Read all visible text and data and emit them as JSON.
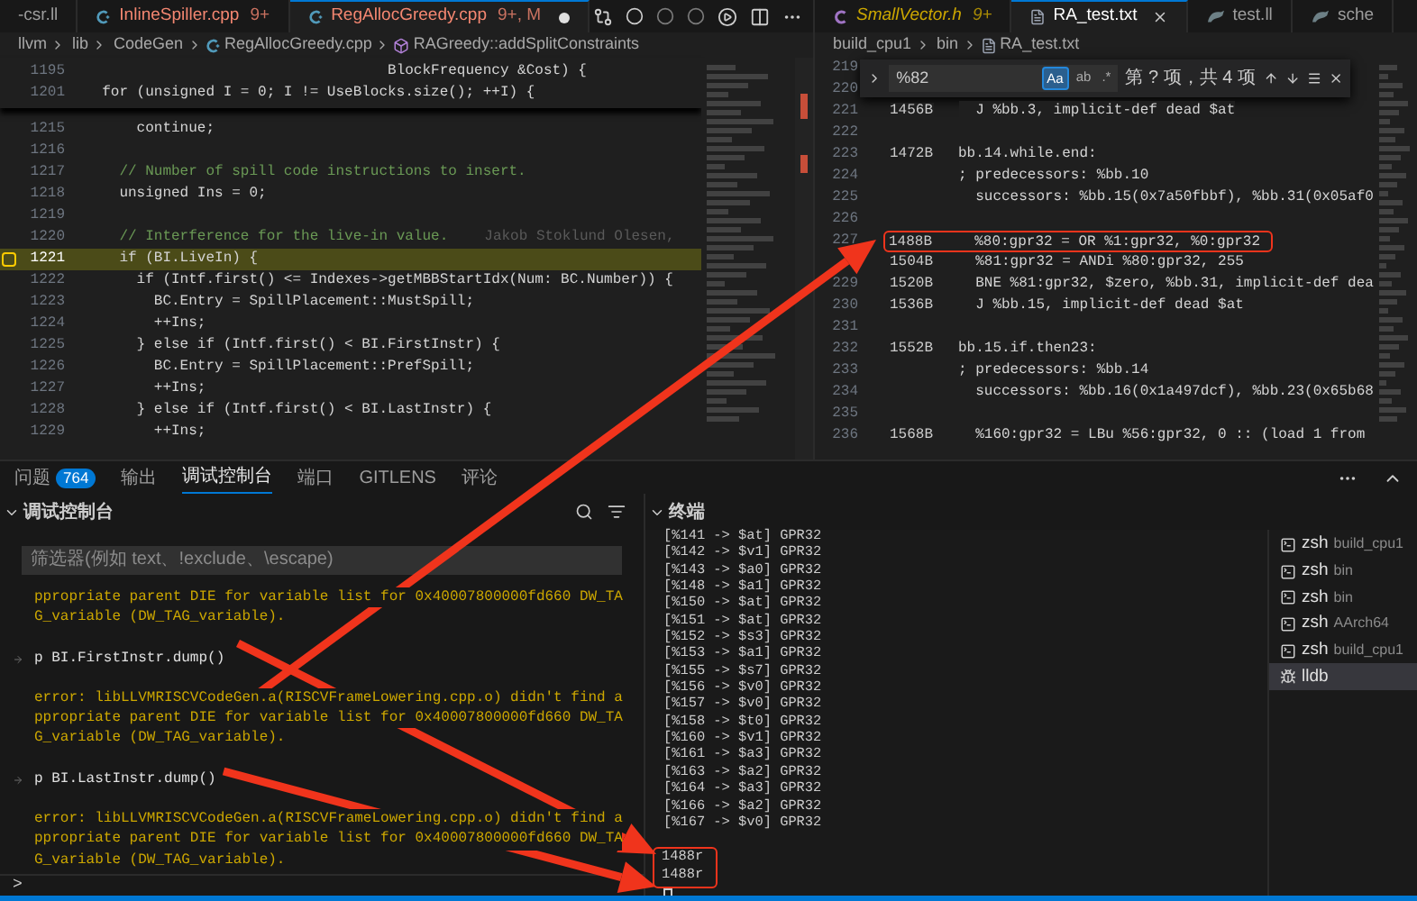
{
  "editor_left": {
    "tabs": [
      {
        "label": "-csr.ll",
        "kind": "none",
        "error": false,
        "warning": false,
        "selected": false,
        "dirty": false
      },
      {
        "label": "InlineSpiller.cpp",
        "badge": "9+",
        "kind": "cpp",
        "error": true,
        "warning": false,
        "selected": false,
        "dirty": false
      },
      {
        "label": "RegAllocGreedy.cpp",
        "badge": "9+, M",
        "kind": "cpp",
        "error": true,
        "warning": false,
        "selected": true,
        "dirty": true
      }
    ],
    "breadcrumbs": [
      {
        "label": "llvm",
        "kind": "folder"
      },
      {
        "label": "lib",
        "kind": "folder"
      },
      {
        "label": "CodeGen",
        "kind": "folder"
      },
      {
        "label": "RegAllocGreedy.cpp",
        "kind": "cpp"
      },
      {
        "label": "RAGreedy::addSplitConstraints",
        "kind": "method"
      }
    ],
    "sticky_lines": [
      {
        "number": "1195",
        "text": "                                   BlockFrequency &Cost) {"
      },
      {
        "number": "1201",
        "text": "  for (unsigned I = 0; I != UseBlocks.size(); ++I) {"
      }
    ],
    "lines": [
      {
        "number": "1215",
        "kind": "code",
        "text": "      continue;",
        "current": false
      },
      {
        "number": "1216",
        "kind": "blank",
        "current": false
      },
      {
        "number": "1217",
        "kind": "comment",
        "text": "    // Number of spill code instructions to insert.",
        "current": false
      },
      {
        "number": "1218",
        "kind": "code",
        "text": "    unsigned Ins = 0;",
        "current": false
      },
      {
        "number": "1219",
        "kind": "blank",
        "current": false
      },
      {
        "number": "1220",
        "kind": "comment",
        "text": "    // Interference for the live-in value.",
        "blame": "Jakob Stoklund Olesen,",
        "current": false
      },
      {
        "number": "1221",
        "kind": "code",
        "text": "    if (BI.LiveIn) {",
        "current": true
      },
      {
        "number": "1222",
        "kind": "code",
        "text": "      if (Intf.first() <= Indexes->getMBBStartIdx(Num: BC.Number)) {",
        "current": false
      },
      {
        "number": "1223",
        "kind": "code",
        "text": "        BC.Entry = SpillPlacement::MustSpill;",
        "current": false
      },
      {
        "number": "1224",
        "kind": "code",
        "text": "        ++Ins;",
        "current": false
      },
      {
        "number": "1225",
        "kind": "code",
        "text": "      } else if (Intf.first() < BI.FirstInstr) {",
        "current": false
      },
      {
        "number": "1226",
        "kind": "code",
        "text": "        BC.Entry = SpillPlacement::PrefSpill;",
        "current": false
      },
      {
        "number": "1227",
        "kind": "code",
        "text": "        ++Ins;",
        "current": false
      },
      {
        "number": "1228",
        "kind": "code",
        "text": "      } else if (Intf.first() < BI.LastInstr) {",
        "current": false
      },
      {
        "number": "1229",
        "kind": "code",
        "text": "        ++Ins;",
        "current": false
      }
    ]
  },
  "editor_right": {
    "tabs": [
      {
        "label": "SmallVector.h",
        "badge": "9+",
        "kind": "c",
        "error": false,
        "warning": true,
        "selected": false,
        "preview": true
      },
      {
        "label": "RA_test.txt",
        "kind": "txt",
        "error": false,
        "warning": false,
        "selected": true,
        "preview": false
      },
      {
        "label": "test.ll",
        "kind": "ll",
        "error": false,
        "warning": false,
        "selected": false,
        "preview": false
      },
      {
        "label": "sche",
        "kind": "ll",
        "error": false,
        "warning": false,
        "selected": false,
        "preview": false
      }
    ],
    "breadcrumbs": [
      {
        "label": "build_cpu1",
        "kind": "folder"
      },
      {
        "label": "bin",
        "kind": "folder"
      },
      {
        "label": "RA_test.txt",
        "kind": "txt"
      }
    ],
    "find": {
      "value": "%82",
      "options": [
        {
          "label": "Aa",
          "on": true
        },
        {
          "label": "ab",
          "on": false
        },
        {
          "label": ".*",
          "on": false
        }
      ],
      "result": "第 ? 项，共 4 项"
    },
    "lines": [
      {
        "number": "219",
        "annotated": false
      },
      {
        "number": "220",
        "annotated": false
      },
      {
        "number": "221",
        "offset": "1456B",
        "text": "  J %bb.3, implicit-def dead $at",
        "annotated": false
      },
      {
        "number": "222",
        "annotated": false
      },
      {
        "number": "223",
        "offset": "1472B",
        "text": "bb.14.while.end:",
        "annotated": false
      },
      {
        "number": "224",
        "text": "; predecessors: %bb.10",
        "annotated": false
      },
      {
        "number": "225",
        "text": "  successors: %bb.15(0x7a50fbbf), %bb.31(0x05af0",
        "annotated": false
      },
      {
        "number": "226",
        "annotated": false
      },
      {
        "number": "227",
        "offset": "1488B",
        "text": "  %80:gpr32 = OR %1:gpr32, %0:gpr32",
        "annotated": true
      },
      {
        "offset": "1504B",
        "text": "  %81:gpr32 = ANDi %80:gpr32, 255",
        "annotated": false
      },
      {
        "number": "229",
        "offset": "1520B",
        "text": "  BNE %81:gpr32, $zero, %bb.31, implicit-def dea",
        "annotated": false
      },
      {
        "number": "230",
        "offset": "1536B",
        "text": "  J %bb.15, implicit-def dead $at",
        "annotated": false
      },
      {
        "number": "231",
        "annotated": false
      },
      {
        "number": "232",
        "offset": "1552B",
        "text": "bb.15.if.then23:",
        "annotated": false
      },
      {
        "number": "233",
        "text": "; predecessors: %bb.14",
        "annotated": false
      },
      {
        "number": "234",
        "text": "  successors: %bb.16(0x1a497dcf), %bb.23(0x65b68",
        "annotated": false
      },
      {
        "number": "235",
        "annotated": false
      },
      {
        "number": "236",
        "offset": "1568B",
        "text": "  %160:gpr32 = LBu %56:gpr32, 0 :: (load 1 from",
        "annotated": false
      }
    ]
  },
  "panel": {
    "tabs": [
      {
        "label": "问题",
        "badge": "764",
        "selected": false
      },
      {
        "label": "输出",
        "selected": false
      },
      {
        "label": "调试控制台",
        "selected": true
      },
      {
        "label": "端口",
        "selected": false
      },
      {
        "label": "GITLENS",
        "selected": false
      },
      {
        "label": "评论",
        "selected": false
      }
    ],
    "debug_console": {
      "title": "调试控制台",
      "expanded": true,
      "filter": {
        "placeholder": "筛选器(例如 text、!exclude、\\escape)"
      },
      "entries": [
        {
          "kind": "error",
          "lines": [
            "ppropriate parent DIE for variable list for 0x40007800000fd660 DW_TA",
            "G_variable (DW_TAG_variable)."
          ]
        },
        {
          "kind": "input",
          "lines": [
            "p BI.FirstInstr.dump()"
          ]
        },
        {
          "kind": "error",
          "lines": [
            "error: libLLVMRISCVCodeGen.a(RISCVFrameLowering.cpp.o) didn't find a",
            "ppropriate parent DIE for variable list for 0x40007800000fd660 DW_TA",
            "G_variable (DW_TAG_variable)."
          ]
        },
        {
          "kind": "input",
          "lines": [
            "p BI.LastInstr.dump()"
          ]
        },
        {
          "kind": "error",
          "lines": [
            "error: libLLVMRISCVCodeGen.a(RISCVFrameLowering.cpp.o) didn't find a",
            "ppropriate parent DIE for variable list for 0x40007800000fd660 DW_TA",
            "G_variable (DW_TAG_variable)."
          ]
        }
      ],
      "prompt": ">"
    },
    "terminal": {
      "title": "终端",
      "expanded": true,
      "lines": [
        "[%141 -> $at] GPR32",
        "[%142 -> $v1] GPR32",
        "[%143 -> $a0] GPR32",
        "[%148 -> $a1] GPR32",
        "[%150 -> $at] GPR32",
        "[%151 -> $at] GPR32",
        "[%152 -> $s3] GPR32",
        "[%153 -> $a1] GPR32",
        "[%155 -> $s7] GPR32",
        "[%156 -> $v0] GPR32",
        "[%157 -> $v0] GPR32",
        "[%158 -> $t0] GPR32",
        "[%160 -> $v1] GPR32",
        "[%161 -> $a3] GPR32",
        "[%163 -> $a2] GPR32",
        "[%164 -> $a3] GPR32",
        "[%166 -> $a2] GPR32",
        "[%167 -> $v0] GPR32"
      ],
      "outlined_lines": [
        "1488r",
        "1488r"
      ],
      "sessions": [
        {
          "name": "zsh",
          "detail": "build_cpu1",
          "kind": "shell",
          "selected": false
        },
        {
          "name": "zsh",
          "detail": "bin",
          "kind": "shell",
          "selected": false
        },
        {
          "name": "zsh",
          "detail": "bin",
          "kind": "shell",
          "selected": false
        },
        {
          "name": "zsh",
          "detail": "AArch64",
          "kind": "shell",
          "selected": false
        },
        {
          "name": "zsh",
          "detail": "build_cpu1",
          "kind": "shell",
          "selected": false
        },
        {
          "name": "lldb",
          "kind": "debug",
          "selected": true
        }
      ]
    }
  }
}
